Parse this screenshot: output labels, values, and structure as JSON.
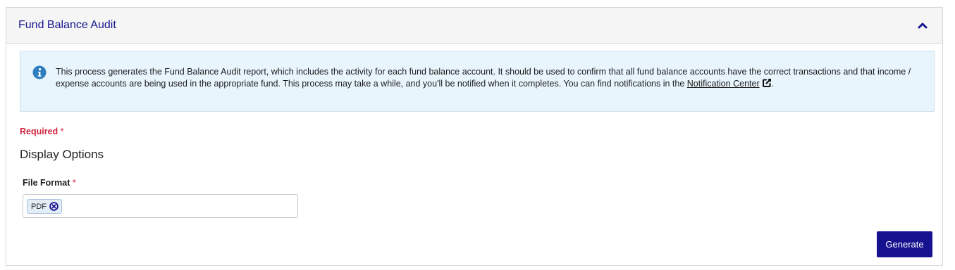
{
  "panel": {
    "title": "Fund Balance Audit",
    "collapse_icon": "chevron-up-icon"
  },
  "info": {
    "icon": "info-circle-icon",
    "text": "This process generates the Fund Balance Audit report, which includes the activity for each fund balance account.  It should be used to confirm that all fund balance accounts have the correct transactions and that income / expense accounts are being used in the appropriate fund.  This process may take a while, and you'll be notified when it completes.  You can find notifications in the ",
    "link_text": "Notification Center",
    "link_icon": "external-link-icon",
    "trailing": "."
  },
  "form": {
    "required_label": "Required",
    "required_star": "*",
    "section_title": "Display Options",
    "file_format": {
      "label": "File Format",
      "star": "*",
      "selected": "PDF",
      "remove_icon": "remove-circle-icon"
    }
  },
  "actions": {
    "generate_label": "Generate"
  },
  "colors": {
    "title": "#16178f",
    "info_bg": "#e8f5fd",
    "info_icon": "#2f7fc0",
    "required": "#d0213c",
    "primary_button": "#16118f"
  }
}
